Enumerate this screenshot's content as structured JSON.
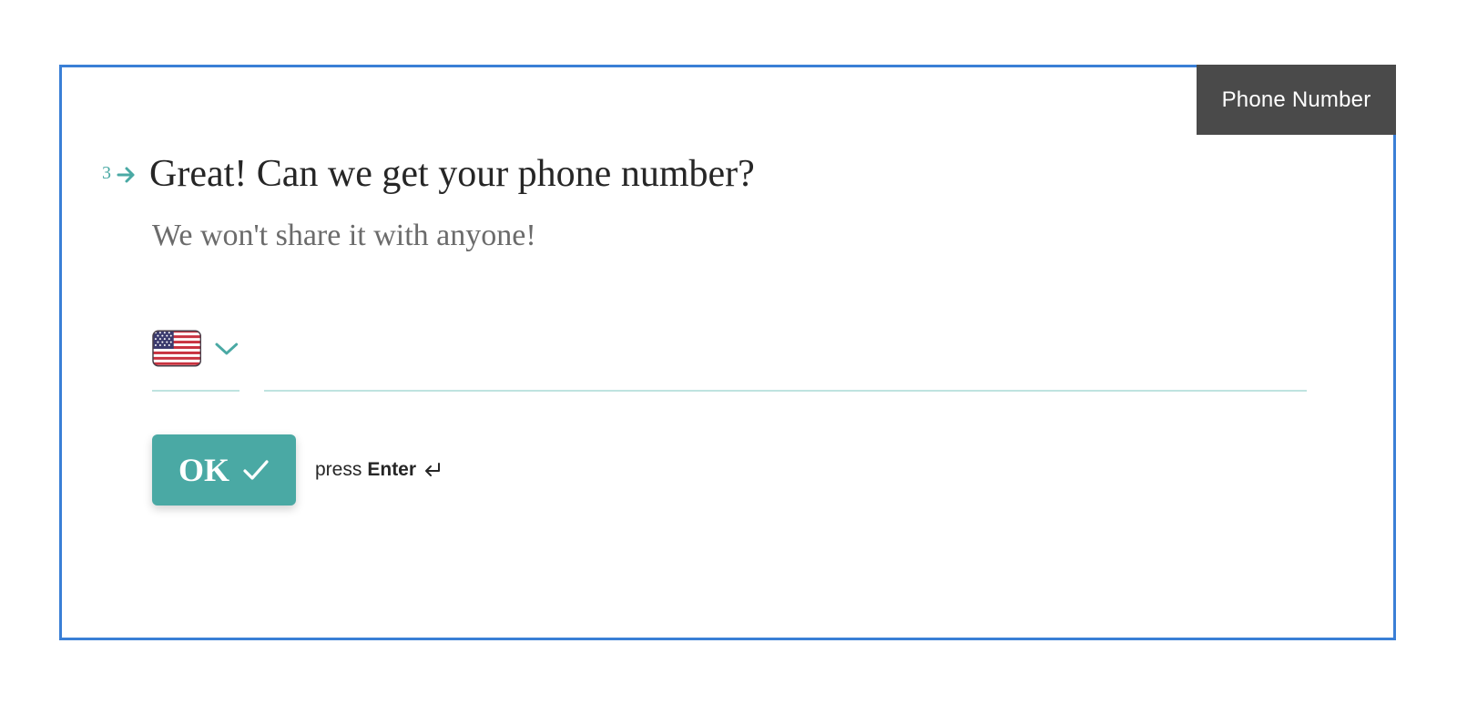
{
  "tag": {
    "label": "Phone Number"
  },
  "question": {
    "number": "3",
    "title": "Great! Can we get your phone number?",
    "subtitle": "We won't share it with anyone!"
  },
  "country_select": {
    "selected_flag": "us-flag-icon"
  },
  "phone_input": {
    "value": "",
    "placeholder": ""
  },
  "ok_button": {
    "label": "OK",
    "icon": "check-icon"
  },
  "hint": {
    "prefix": "press",
    "key": "Enter",
    "icon": "enter-key-icon"
  },
  "colors": {
    "accent": "#4aa9a4",
    "frame_border": "#3a7fd6",
    "tag_background": "#4a4a4a",
    "underline": "#bfe3e0"
  }
}
